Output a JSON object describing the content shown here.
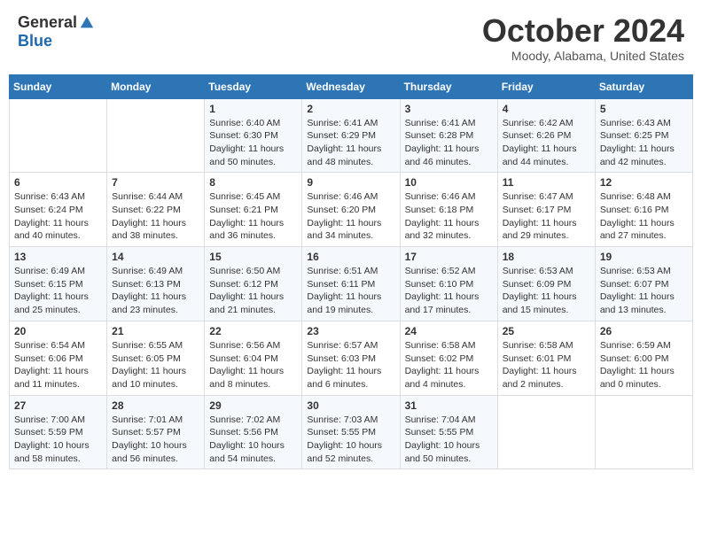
{
  "header": {
    "logo_general": "General",
    "logo_blue": "Blue",
    "title": "October 2024",
    "location": "Moody, Alabama, United States"
  },
  "days_of_week": [
    "Sunday",
    "Monday",
    "Tuesday",
    "Wednesday",
    "Thursday",
    "Friday",
    "Saturday"
  ],
  "weeks": [
    [
      {
        "day": "",
        "info": ""
      },
      {
        "day": "",
        "info": ""
      },
      {
        "day": "1",
        "info": "Sunrise: 6:40 AM\nSunset: 6:30 PM\nDaylight: 11 hours and 50 minutes."
      },
      {
        "day": "2",
        "info": "Sunrise: 6:41 AM\nSunset: 6:29 PM\nDaylight: 11 hours and 48 minutes."
      },
      {
        "day": "3",
        "info": "Sunrise: 6:41 AM\nSunset: 6:28 PM\nDaylight: 11 hours and 46 minutes."
      },
      {
        "day": "4",
        "info": "Sunrise: 6:42 AM\nSunset: 6:26 PM\nDaylight: 11 hours and 44 minutes."
      },
      {
        "day": "5",
        "info": "Sunrise: 6:43 AM\nSunset: 6:25 PM\nDaylight: 11 hours and 42 minutes."
      }
    ],
    [
      {
        "day": "6",
        "info": "Sunrise: 6:43 AM\nSunset: 6:24 PM\nDaylight: 11 hours and 40 minutes."
      },
      {
        "day": "7",
        "info": "Sunrise: 6:44 AM\nSunset: 6:22 PM\nDaylight: 11 hours and 38 minutes."
      },
      {
        "day": "8",
        "info": "Sunrise: 6:45 AM\nSunset: 6:21 PM\nDaylight: 11 hours and 36 minutes."
      },
      {
        "day": "9",
        "info": "Sunrise: 6:46 AM\nSunset: 6:20 PM\nDaylight: 11 hours and 34 minutes."
      },
      {
        "day": "10",
        "info": "Sunrise: 6:46 AM\nSunset: 6:18 PM\nDaylight: 11 hours and 32 minutes."
      },
      {
        "day": "11",
        "info": "Sunrise: 6:47 AM\nSunset: 6:17 PM\nDaylight: 11 hours and 29 minutes."
      },
      {
        "day": "12",
        "info": "Sunrise: 6:48 AM\nSunset: 6:16 PM\nDaylight: 11 hours and 27 minutes."
      }
    ],
    [
      {
        "day": "13",
        "info": "Sunrise: 6:49 AM\nSunset: 6:15 PM\nDaylight: 11 hours and 25 minutes."
      },
      {
        "day": "14",
        "info": "Sunrise: 6:49 AM\nSunset: 6:13 PM\nDaylight: 11 hours and 23 minutes."
      },
      {
        "day": "15",
        "info": "Sunrise: 6:50 AM\nSunset: 6:12 PM\nDaylight: 11 hours and 21 minutes."
      },
      {
        "day": "16",
        "info": "Sunrise: 6:51 AM\nSunset: 6:11 PM\nDaylight: 11 hours and 19 minutes."
      },
      {
        "day": "17",
        "info": "Sunrise: 6:52 AM\nSunset: 6:10 PM\nDaylight: 11 hours and 17 minutes."
      },
      {
        "day": "18",
        "info": "Sunrise: 6:53 AM\nSunset: 6:09 PM\nDaylight: 11 hours and 15 minutes."
      },
      {
        "day": "19",
        "info": "Sunrise: 6:53 AM\nSunset: 6:07 PM\nDaylight: 11 hours and 13 minutes."
      }
    ],
    [
      {
        "day": "20",
        "info": "Sunrise: 6:54 AM\nSunset: 6:06 PM\nDaylight: 11 hours and 11 minutes."
      },
      {
        "day": "21",
        "info": "Sunrise: 6:55 AM\nSunset: 6:05 PM\nDaylight: 11 hours and 10 minutes."
      },
      {
        "day": "22",
        "info": "Sunrise: 6:56 AM\nSunset: 6:04 PM\nDaylight: 11 hours and 8 minutes."
      },
      {
        "day": "23",
        "info": "Sunrise: 6:57 AM\nSunset: 6:03 PM\nDaylight: 11 hours and 6 minutes."
      },
      {
        "day": "24",
        "info": "Sunrise: 6:58 AM\nSunset: 6:02 PM\nDaylight: 11 hours and 4 minutes."
      },
      {
        "day": "25",
        "info": "Sunrise: 6:58 AM\nSunset: 6:01 PM\nDaylight: 11 hours and 2 minutes."
      },
      {
        "day": "26",
        "info": "Sunrise: 6:59 AM\nSunset: 6:00 PM\nDaylight: 11 hours and 0 minutes."
      }
    ],
    [
      {
        "day": "27",
        "info": "Sunrise: 7:00 AM\nSunset: 5:59 PM\nDaylight: 10 hours and 58 minutes."
      },
      {
        "day": "28",
        "info": "Sunrise: 7:01 AM\nSunset: 5:57 PM\nDaylight: 10 hours and 56 minutes."
      },
      {
        "day": "29",
        "info": "Sunrise: 7:02 AM\nSunset: 5:56 PM\nDaylight: 10 hours and 54 minutes."
      },
      {
        "day": "30",
        "info": "Sunrise: 7:03 AM\nSunset: 5:55 PM\nDaylight: 10 hours and 52 minutes."
      },
      {
        "day": "31",
        "info": "Sunrise: 7:04 AM\nSunset: 5:55 PM\nDaylight: 10 hours and 50 minutes."
      },
      {
        "day": "",
        "info": ""
      },
      {
        "day": "",
        "info": ""
      }
    ]
  ]
}
